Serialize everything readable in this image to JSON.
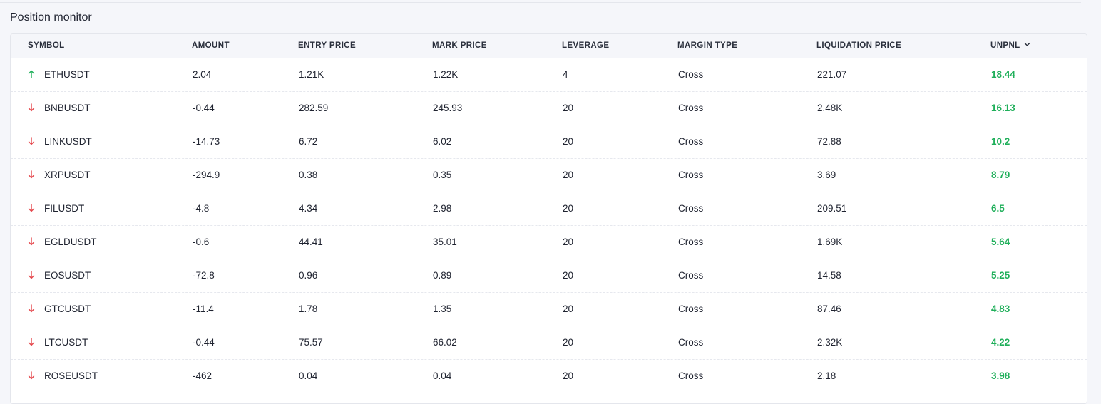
{
  "page": {
    "title": "Position monitor"
  },
  "colors": {
    "up": "#1faf5a",
    "down": "#e5484d",
    "pnl": "#1faf5a"
  },
  "table": {
    "columns": {
      "symbol": "SYMBOL",
      "amount": "AMOUNT",
      "entry_price": "ENTRY PRICE",
      "mark_price": "MARK PRICE",
      "leverage": "LEVERAGE",
      "margin_type": "MARGIN TYPE",
      "liquidation_price": "LIQUIDATION PRICE",
      "unpnl": "UNPNL"
    },
    "sort_icon": "chevron-down-icon",
    "rows": [
      {
        "direction": "up",
        "symbol": "ETHUSDT",
        "amount": "2.04",
        "entry_price": "1.21K",
        "mark_price": "1.22K",
        "leverage": "4",
        "margin_type": "Cross",
        "liquidation_price": "221.07",
        "unpnl": "18.44"
      },
      {
        "direction": "down",
        "symbol": "BNBUSDT",
        "amount": "-0.44",
        "entry_price": "282.59",
        "mark_price": "245.93",
        "leverage": "20",
        "margin_type": "Cross",
        "liquidation_price": "2.48K",
        "unpnl": "16.13"
      },
      {
        "direction": "down",
        "symbol": "LINKUSDT",
        "amount": "-14.73",
        "entry_price": "6.72",
        "mark_price": "6.02",
        "leverage": "20",
        "margin_type": "Cross",
        "liquidation_price": "72.88",
        "unpnl": "10.2"
      },
      {
        "direction": "down",
        "symbol": "XRPUSDT",
        "amount": "-294.9",
        "entry_price": "0.38",
        "mark_price": "0.35",
        "leverage": "20",
        "margin_type": "Cross",
        "liquidation_price": "3.69",
        "unpnl": "8.79"
      },
      {
        "direction": "down",
        "symbol": "FILUSDT",
        "amount": "-4.8",
        "entry_price": "4.34",
        "mark_price": "2.98",
        "leverage": "20",
        "margin_type": "Cross",
        "liquidation_price": "209.51",
        "unpnl": "6.5"
      },
      {
        "direction": "down",
        "symbol": "EGLDUSDT",
        "amount": "-0.6",
        "entry_price": "44.41",
        "mark_price": "35.01",
        "leverage": "20",
        "margin_type": "Cross",
        "liquidation_price": "1.69K",
        "unpnl": "5.64"
      },
      {
        "direction": "down",
        "symbol": "EOSUSDT",
        "amount": "-72.8",
        "entry_price": "0.96",
        "mark_price": "0.89",
        "leverage": "20",
        "margin_type": "Cross",
        "liquidation_price": "14.58",
        "unpnl": "5.25"
      },
      {
        "direction": "down",
        "symbol": "GTCUSDT",
        "amount": "-11.4",
        "entry_price": "1.78",
        "mark_price": "1.35",
        "leverage": "20",
        "margin_type": "Cross",
        "liquidation_price": "87.46",
        "unpnl": "4.83"
      },
      {
        "direction": "down",
        "symbol": "LTCUSDT",
        "amount": "-0.44",
        "entry_price": "75.57",
        "mark_price": "66.02",
        "leverage": "20",
        "margin_type": "Cross",
        "liquidation_price": "2.32K",
        "unpnl": "4.22"
      },
      {
        "direction": "down",
        "symbol": "ROSEUSDT",
        "amount": "-462",
        "entry_price": "0.04",
        "mark_price": "0.04",
        "leverage": "20",
        "margin_type": "Cross",
        "liquidation_price": "2.18",
        "unpnl": "3.98"
      }
    ]
  }
}
